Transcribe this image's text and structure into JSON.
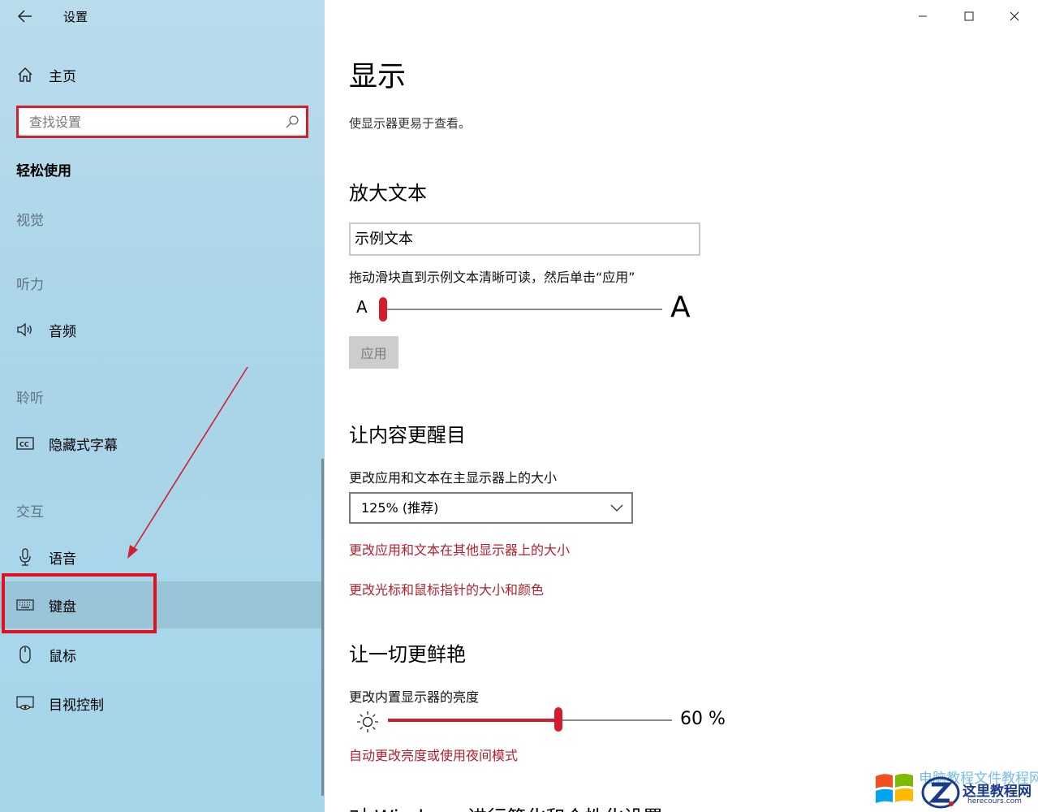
{
  "app": {
    "title": "设置"
  },
  "sidebar": {
    "home_label": "主页",
    "search_placeholder": "查找设置",
    "section_title": "轻松使用",
    "categories": {
      "vision": "视觉",
      "hearing": "听力",
      "listening": "聆听",
      "interaction": "交互"
    },
    "items": {
      "audio": "音频",
      "captions": "隐藏式字幕",
      "speech": "语音",
      "keyboard": "键盘",
      "mouse": "鼠标",
      "eye_control": "目视控制"
    }
  },
  "main": {
    "title": "显示",
    "description": "使显示器更易于查看。",
    "text_section": {
      "heading": "放大文本",
      "sample": "示例文本",
      "instruction": "拖动滑块直到示例文本清晰可读，然后单击“应用”",
      "small_a": "A",
      "big_a": "A",
      "apply_label": "应用"
    },
    "emphasis_section": {
      "heading": "让内容更醒目",
      "scale_label": "更改应用和文本在主显示器上的大小",
      "scale_value": "125% (推荐)",
      "link_other_displays": "更改应用和文本在其他显示器上的大小",
      "link_cursor": "更改光标和鼠标指针的大小和颜色"
    },
    "brightness_section": {
      "heading": "让一切更鲜艳",
      "label": "更改内置显示器的亮度",
      "value_text": "60 %",
      "value_fraction": 0.6,
      "link_night": "自动更改亮度或使用夜间模式"
    },
    "cut_heading": "对 Windows 进行简化和个性化设置"
  },
  "watermark": {
    "faded_text": "电脑教程文件教程网",
    "name": "这里教程网",
    "url": "herecours.com"
  },
  "colors": {
    "accent": "#d11d2d",
    "link": "#b5202e",
    "sidebar_bg": "#abd5e9",
    "highlight": "#e0101e"
  }
}
